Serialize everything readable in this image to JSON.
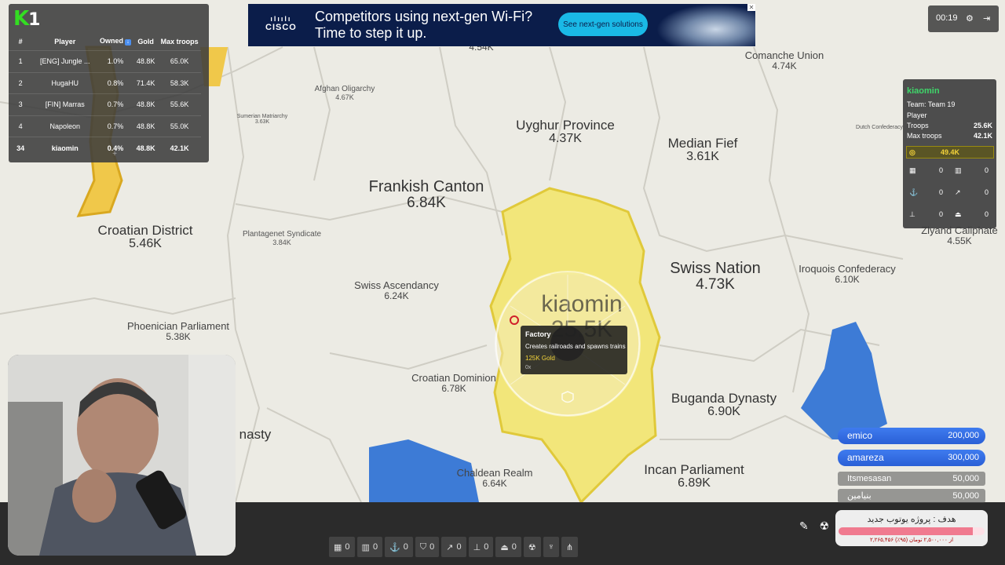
{
  "map": {
    "regions": [
      {
        "name": "Frankish Canton",
        "value": "6.84K",
        "size": "lg"
      },
      {
        "name": "Croatian District",
        "value": "5.46K",
        "size": "md"
      },
      {
        "name": "Uyghur Province",
        "value": "4.37K",
        "size": "md"
      },
      {
        "name": "Median Fief",
        "value": "3.61K",
        "size": "md"
      },
      {
        "name": "Swiss Nation",
        "value": "4.73K",
        "size": "lg"
      },
      {
        "name": "Swiss Ascendancy",
        "value": "6.24K",
        "size": "sm"
      },
      {
        "name": "Phoenician Parliament",
        "value": "5.38K",
        "size": "sm"
      },
      {
        "name": "Croatian Dominion",
        "value": "6.78K",
        "size": "sm"
      },
      {
        "name": "Buganda Dynasty",
        "value": "6.90K",
        "size": "md"
      },
      {
        "name": "Incan Parliament",
        "value": "6.89K",
        "size": "md"
      },
      {
        "name": "Chaldean Realm",
        "value": "6.64K",
        "size": "sm"
      },
      {
        "name": "Iroquois Confederacy",
        "value": "6.10K",
        "size": "sm"
      },
      {
        "name": "Comanche Union",
        "value": "4.74K",
        "size": "sm"
      },
      {
        "name": "Zlyand Caliphate",
        "value": "4.55K",
        "size": "sm"
      },
      {
        "name": "Afghan Oligarchy",
        "value": "4.67K",
        "size": "xs"
      },
      {
        "name": "Plantagenet Syndicate",
        "value": "3.84K",
        "size": "xs"
      },
      {
        "name": "Sumerian Matriarchy",
        "value": "3.63K",
        "size": "xxs"
      },
      {
        "name": "Dutch Confederacy",
        "value": "",
        "size": "xxs"
      },
      {
        "name": "nasty",
        "value": "",
        "size": "md"
      }
    ],
    "top_value": "4.54K",
    "player_label": {
      "name": "kiaomin",
      "value": "25.5K"
    }
  },
  "leaderboard": {
    "logo_main": "K",
    "logo_num": "1",
    "headers": [
      "#",
      "Player",
      "Owned",
      "Gold",
      "Max troops"
    ],
    "rows": [
      {
        "rank": "1",
        "player": "[ENG] Jungle ...",
        "owned": "1.0%",
        "gold": "48.8K",
        "troops": "65.0K"
      },
      {
        "rank": "2",
        "player": "HugaHU",
        "owned": "0.8%",
        "gold": "71.4K",
        "troops": "58.3K"
      },
      {
        "rank": "3",
        "player": "[FIN] Marras",
        "owned": "0.7%",
        "gold": "48.8K",
        "troops": "55.6K"
      },
      {
        "rank": "4",
        "player": "Napoleon",
        "owned": "0.7%",
        "gold": "48.8K",
        "troops": "55.0K"
      },
      {
        "rank": "34",
        "player": "kiaomin",
        "owned": "0.4%",
        "gold": "48.8K",
        "troops": "42.1K"
      }
    ],
    "expand": "+"
  },
  "ad": {
    "brand": "CISCO",
    "line1": "Competitors using next-gen Wi-Fi?",
    "line2": "Time to step it up.",
    "cta": "See next-gen solutions"
  },
  "topbar": {
    "timer": "00:19"
  },
  "player_info": {
    "name": "kiaomin",
    "team": "Team: Team 19",
    "type": "Player",
    "troops_label": "Troops",
    "troops": "25.6K",
    "max_label": "Max troops",
    "max": "42.1K",
    "gold": "49.4K",
    "counts": [
      "0",
      "0",
      "0",
      "0",
      "0",
      "0"
    ]
  },
  "tooltip": {
    "title": "Factory",
    "desc": "Creates railroads and spawns trains",
    "cost": "125K Gold",
    "count": "0x"
  },
  "donations": [
    {
      "name": "emico",
      "amount": "200,000",
      "style": "blue"
    },
    {
      "name": "amareza",
      "amount": "300,000",
      "style": "blue"
    },
    {
      "name": "Itsmesasan",
      "amount": "50,000",
      "style": "gray"
    },
    {
      "name": "بنیامین",
      "amount": "50,000",
      "style": "gray"
    }
  ],
  "goal": {
    "title": "هدف : پروژه یوتوب جدید",
    "progress": 0.92,
    "sub": "۲,۲۶۵,۴۵۶ از ۲,۵۰۰,۰۰۰ تومان (۹۵٪)"
  },
  "build_bar": [
    "0",
    "0",
    "0",
    "0",
    "0",
    "0",
    "0",
    "0"
  ],
  "colors": {
    "territory": "#f2e67a",
    "water": "#3d7bd6",
    "accent_green": "#3fd66a",
    "gold": "#f5d33a"
  }
}
